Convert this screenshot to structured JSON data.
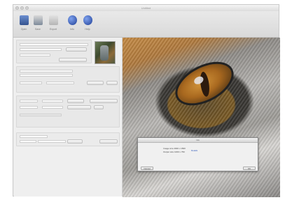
{
  "window": {
    "title": "Untitled"
  },
  "toolbar": {
    "items": [
      {
        "label": "Open",
        "icon": "open-file-icon",
        "color": "#4a6fb0"
      },
      {
        "label": "Save",
        "icon": "save-icon",
        "color": "#5a6a80"
      },
      {
        "label": "Export",
        "icon": "export-icon",
        "color": "#9a9a9a"
      },
      {
        "label": "Info",
        "icon": "info-globe-icon",
        "color": "#2b55b8"
      },
      {
        "label": "Help",
        "icon": "help-globe-icon",
        "color": "#2b55b8"
      }
    ]
  },
  "dialog": {
    "title": "Info",
    "line1": "Image size 2000 x 1500",
    "line2": "Output size 1000 x 750",
    "link": "Details",
    "cancel_label": "Cancel",
    "ok_label": "OK"
  },
  "colors": {
    "accent": "#2b55b8",
    "window_bg": "#ececec"
  }
}
